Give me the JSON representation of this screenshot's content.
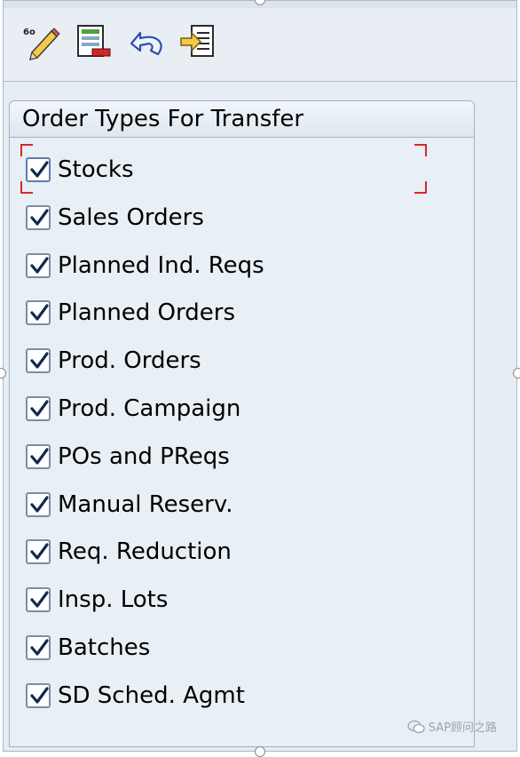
{
  "toolbar": {
    "buttons": [
      {
        "name": "edit-pencil-icon"
      },
      {
        "name": "layout-table-icon"
      },
      {
        "name": "undo-arrow-icon"
      },
      {
        "name": "transfer-document-icon"
      }
    ]
  },
  "group": {
    "title": "Order Types For Transfer",
    "items": [
      {
        "label": "Stocks",
        "checked": true,
        "focused": true
      },
      {
        "label": "Sales Orders",
        "checked": true
      },
      {
        "label": "Planned Ind. Reqs",
        "checked": true
      },
      {
        "label": "Planned Orders",
        "checked": true
      },
      {
        "label": "Prod. Orders",
        "checked": true
      },
      {
        "label": "Prod. Campaign",
        "checked": true
      },
      {
        "label": "POs and PReqs",
        "checked": true
      },
      {
        "label": "Manual Reserv.",
        "checked": true
      },
      {
        "label": "Req. Reduction",
        "checked": true
      },
      {
        "label": "Insp. Lots",
        "checked": true
      },
      {
        "label": "Batches",
        "checked": true
      },
      {
        "label": "SD Sched. Agmt",
        "checked": true
      }
    ]
  },
  "watermark": {
    "text": "SAP顾问之路"
  },
  "colors": {
    "focus": "#d4292b",
    "panel": "#e6edf3",
    "border": "#9fb3c7"
  }
}
